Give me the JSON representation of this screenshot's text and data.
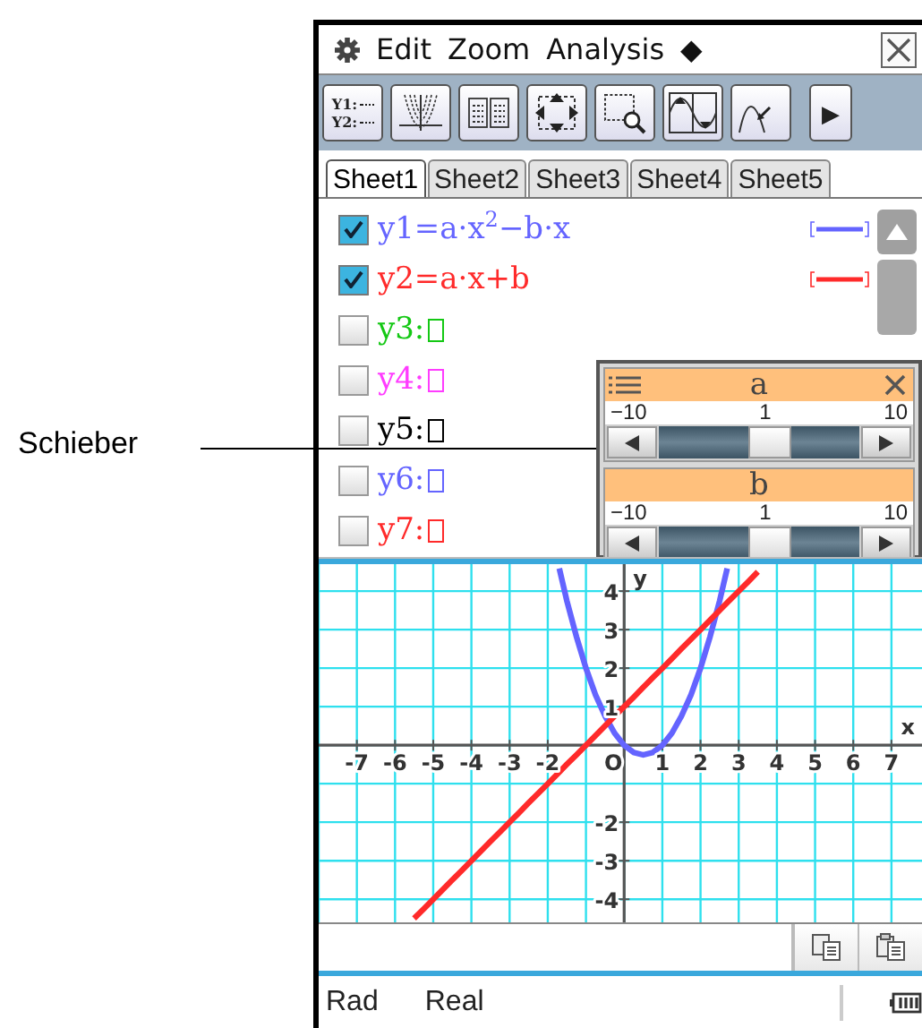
{
  "annotation": {
    "label": "Schieber"
  },
  "menu": {
    "items": [
      "Edit",
      "Zoom",
      "Analysis"
    ],
    "more": "◆"
  },
  "toolbar": {
    "buttons": [
      {
        "kind": "equations",
        "lines": [
          "Y1:",
          "Y2:"
        ]
      },
      {
        "kind": "family"
      },
      {
        "kind": "table"
      },
      {
        "kind": "pan"
      },
      {
        "kind": "zoom-box"
      },
      {
        "kind": "wave"
      },
      {
        "kind": "trace"
      }
    ],
    "next": "▶"
  },
  "tabs": [
    {
      "label": "Sheet1",
      "selected": true
    },
    {
      "label": "Sheet2",
      "selected": false
    },
    {
      "label": "Sheet3",
      "selected": false
    },
    {
      "label": "Sheet4",
      "selected": false
    },
    {
      "label": "Sheet5",
      "selected": false
    }
  ],
  "functions": [
    {
      "label": "y1=a·x$^{2}$−b·x",
      "kind": "expression",
      "checked": true,
      "color": "#6464ff"
    },
    {
      "label": "y2=a·x+b",
      "kind": "expression",
      "checked": true,
      "color": "#ff2a2a"
    },
    {
      "label": "y3:",
      "kind": "empty",
      "checked": false,
      "color": "#14c814"
    },
    {
      "label": "y4:",
      "kind": "empty",
      "checked": false,
      "color": "#ff3cff"
    },
    {
      "label": "y5:",
      "kind": "empty",
      "checked": false,
      "color": "#000000"
    },
    {
      "label": "y6:",
      "kind": "empty",
      "checked": false,
      "color": "#6464ff"
    },
    {
      "label": "y7:",
      "kind": "empty",
      "checked": false,
      "color": "#ff2a2a"
    }
  ],
  "sliders": [
    {
      "name": "a",
      "min": "−10",
      "value": "1",
      "max": "10",
      "level": 0.55,
      "controls": true
    },
    {
      "name": "b",
      "min": "−10",
      "value": "1",
      "max": "10",
      "level": 0.55,
      "controls": false
    }
  ],
  "graph": {
    "chart_data": {
      "type": "line",
      "xlabel": "x",
      "ylabel": "y",
      "x": [
        -5.5,
        -5.25,
        -5,
        -4.75,
        -4.5,
        -4.25,
        -4,
        -3.75,
        -3.5,
        -3.25,
        -3,
        -2.75,
        -2.5,
        -2.25,
        -2,
        -1.7,
        -1.5,
        -1.25,
        -1,
        -0.75,
        -0.5,
        -0.25,
        0,
        0.25,
        0.5,
        0.75,
        1,
        1.25,
        1.5,
        1.75,
        2,
        2.25,
        2.5,
        2.7,
        3,
        3.25,
        3.5
      ],
      "series": [
        {
          "color": "#6464ff",
          "values": [
            null,
            null,
            null,
            null,
            null,
            null,
            null,
            null,
            null,
            null,
            null,
            null,
            null,
            null,
            null,
            4.59,
            3.75,
            2.81,
            2,
            1.31,
            0.75,
            0.31,
            0,
            -0.19,
            -0.25,
            -0.19,
            0,
            0.31,
            0.75,
            1.31,
            2,
            2.81,
            3.75,
            4.59,
            null,
            null,
            null
          ]
        },
        {
          "color": "#ff2a2a",
          "values": [
            -4.5,
            -4.25,
            -4,
            -3.75,
            -3.5,
            -3.25,
            -3,
            -2.75,
            -2.5,
            -2.25,
            -2,
            -1.75,
            -1.5,
            -1.25,
            -1,
            -0.7,
            -0.5,
            -0.25,
            0,
            0.25,
            0.5,
            0.75,
            1,
            1.25,
            1.5,
            1.75,
            2,
            2.25,
            2.5,
            2.75,
            3,
            3.25,
            3.5,
            3.7,
            4,
            4.25,
            4.5
          ]
        }
      ],
      "grid": true,
      "xlim": [
        -8,
        7.8
      ],
      "ylim": [
        -4.6,
        4.7
      ],
      "xticks": [
        -7,
        -6,
        -5,
        -4,
        -3,
        -2,
        {
          "value": 0,
          "label": "O"
        },
        1,
        2,
        3,
        4,
        5,
        6,
        7
      ],
      "yticks": [
        -4,
        -3,
        -2,
        1,
        2,
        3,
        4
      ]
    }
  },
  "status": {
    "angle": "Rad",
    "mode": "Real"
  }
}
